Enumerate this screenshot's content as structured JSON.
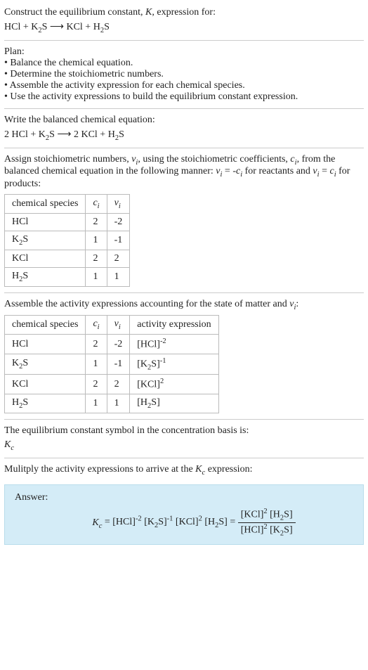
{
  "header": {
    "prompt_line1": "Construct the equilibrium constant, K, expression for:",
    "reaction_unbalanced": "HCl + K₂S ⟶ KCl + H₂S"
  },
  "plan": {
    "title": "Plan:",
    "items": [
      "Balance the chemical equation.",
      "Determine the stoichiometric numbers.",
      "Assemble the activity expression for each chemical species.",
      "Use the activity expressions to build the equilibrium constant expression."
    ]
  },
  "balanced": {
    "intro": "Write the balanced chemical equation:",
    "equation": "2 HCl + K₂S ⟶ 2 KCl + H₂S"
  },
  "stoich": {
    "intro_a": "Assign stoichiometric numbers, νᵢ, using the stoichiometric coefficients, cᵢ, from the balanced chemical equation in the following manner: νᵢ = -cᵢ for reactants and νᵢ = cᵢ for products:",
    "headers": [
      "chemical species",
      "cᵢ",
      "νᵢ"
    ],
    "rows": [
      {
        "species": "HCl",
        "c": "2",
        "v": "-2"
      },
      {
        "species": "K₂S",
        "c": "1",
        "v": "-1"
      },
      {
        "species": "KCl",
        "c": "2",
        "v": "2"
      },
      {
        "species": "H₂S",
        "c": "1",
        "v": "1"
      }
    ]
  },
  "activity": {
    "intro": "Assemble the activity expressions accounting for the state of matter and νᵢ:",
    "headers": [
      "chemical species",
      "cᵢ",
      "νᵢ",
      "activity expression"
    ],
    "rows": [
      {
        "species": "HCl",
        "c": "2",
        "v": "-2",
        "expr": "[HCl]⁻²"
      },
      {
        "species": "K₂S",
        "c": "1",
        "v": "-1",
        "expr": "[K₂S]⁻¹"
      },
      {
        "species": "KCl",
        "c": "2",
        "v": "2",
        "expr": "[KCl]²"
      },
      {
        "species": "H₂S",
        "c": "1",
        "v": "1",
        "expr": "[H₂S]"
      }
    ]
  },
  "symbol": {
    "intro": "The equilibrium constant symbol in the concentration basis is:",
    "sym": "K𝒸"
  },
  "multiply": {
    "intro": "Mulitply the activity expressions to arrive at the K𝒸 expression:"
  },
  "answer": {
    "label": "Answer:",
    "lhs": "K𝒸 = [HCl]⁻² [K₂S]⁻¹ [KCl]² [H₂S] = ",
    "frac_num": "[KCl]² [H₂S]",
    "frac_den": "[HCl]² [K₂S]"
  }
}
